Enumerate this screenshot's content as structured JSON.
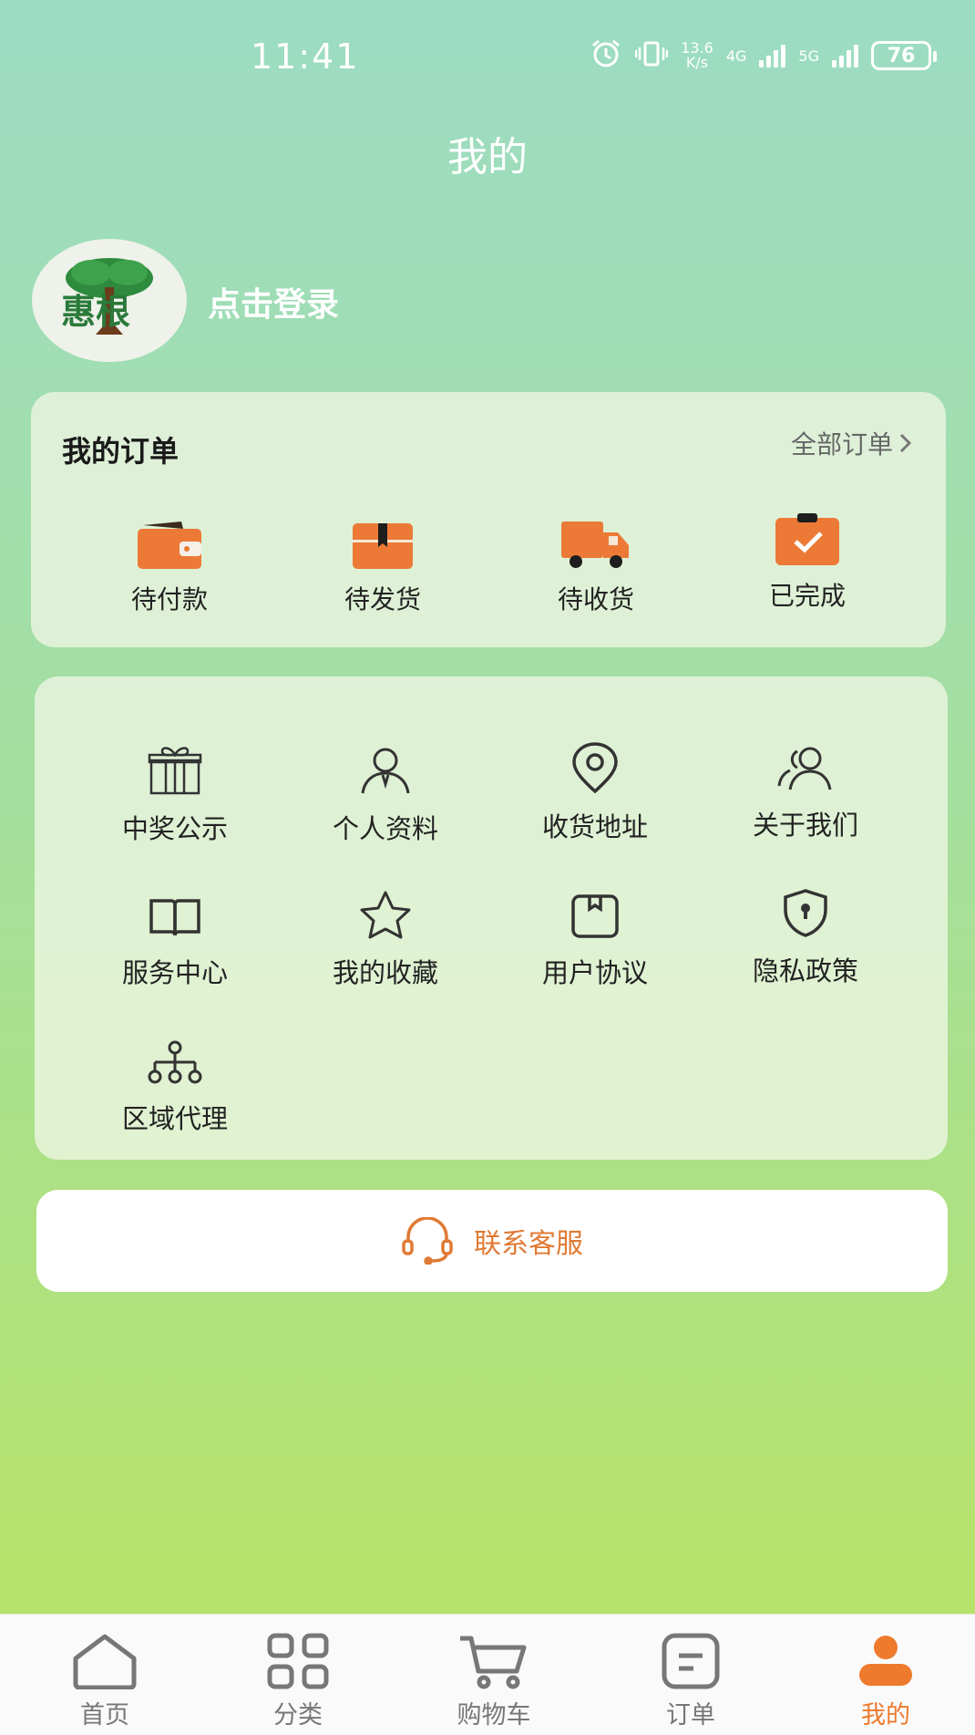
{
  "status_bar": {
    "time": "11:41",
    "net_speed_value": "13.6",
    "net_speed_unit": "K/s",
    "net1": "4G",
    "net2": "5G",
    "battery": "76"
  },
  "page_title": "我的",
  "profile": {
    "login_text": "点击登录",
    "logo_text": "惠根"
  },
  "orders": {
    "title": "我的订单",
    "all_label": "全部订单",
    "items": [
      {
        "label": "待付款",
        "icon": "wallet-icon"
      },
      {
        "label": "待发货",
        "icon": "package-icon"
      },
      {
        "label": "待收货",
        "icon": "truck-icon"
      },
      {
        "label": "已完成",
        "icon": "clipboard-check-icon"
      }
    ]
  },
  "menu": {
    "items": [
      {
        "label": "中奖公示",
        "icon": "gift-icon"
      },
      {
        "label": "个人资料",
        "icon": "user-icon"
      },
      {
        "label": "收货地址",
        "icon": "location-icon"
      },
      {
        "label": "关于我们",
        "icon": "users-icon"
      },
      {
        "label": "服务中心",
        "icon": "book-icon"
      },
      {
        "label": "我的收藏",
        "icon": "star-icon"
      },
      {
        "label": "用户协议",
        "icon": "document-icon"
      },
      {
        "label": "隐私政策",
        "icon": "shield-lock-icon"
      },
      {
        "label": "区域代理",
        "icon": "hierarchy-icon"
      }
    ]
  },
  "service": {
    "label": "联系客服",
    "icon": "headset-icon"
  },
  "tabbar": {
    "items": [
      {
        "label": "首页",
        "icon": "home-icon"
      },
      {
        "label": "分类",
        "icon": "category-icon"
      },
      {
        "label": "购物车",
        "icon": "cart-icon"
      },
      {
        "label": "订单",
        "icon": "order-icon"
      },
      {
        "label": "我的",
        "icon": "profile-icon"
      }
    ],
    "active_index": 4
  },
  "colors": {
    "accent": "#ee7a2e",
    "order_icon": "#ec7a36"
  }
}
